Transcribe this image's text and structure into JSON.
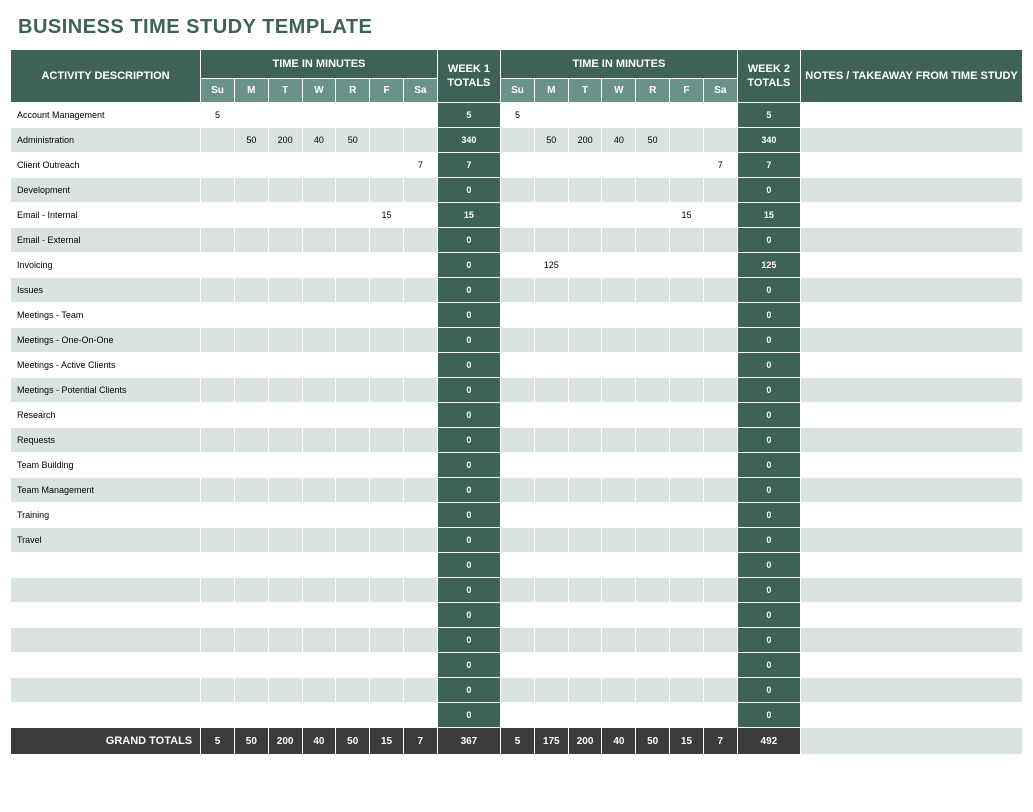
{
  "title": "BUSINESS TIME STUDY TEMPLATE",
  "headers": {
    "activity": "ACTIVITY DESCRIPTION",
    "time_group": "TIME IN MINUTES",
    "week1_totals": "WEEK 1 TOTALS",
    "week2_totals": "WEEK 2 TOTALS",
    "notes": "NOTES / TAKEAWAY FROM TIME STUDY",
    "days": [
      "Su",
      "M",
      "T",
      "W",
      "R",
      "F",
      "Sa"
    ]
  },
  "rows": [
    {
      "activity": "Account Management",
      "w1": [
        "5",
        "",
        "",
        "",
        "",
        "",
        ""
      ],
      "t1": "5",
      "w2": [
        "5",
        "",
        "",
        "",
        "",
        "",
        ""
      ],
      "t2": "5",
      "notes": ""
    },
    {
      "activity": "Administration",
      "w1": [
        "",
        "50",
        "200",
        "40",
        "50",
        "",
        ""
      ],
      "t1": "340",
      "w2": [
        "",
        "50",
        "200",
        "40",
        "50",
        "",
        ""
      ],
      "t2": "340",
      "notes": ""
    },
    {
      "activity": "Client Outreach",
      "w1": [
        "",
        "",
        "",
        "",
        "",
        "",
        "7"
      ],
      "t1": "7",
      "w2": [
        "",
        "",
        "",
        "",
        "",
        "",
        "7"
      ],
      "t2": "7",
      "notes": ""
    },
    {
      "activity": "Development",
      "w1": [
        "",
        "",
        "",
        "",
        "",
        "",
        ""
      ],
      "t1": "0",
      "w2": [
        "",
        "",
        "",
        "",
        "",
        "",
        ""
      ],
      "t2": "0",
      "notes": ""
    },
    {
      "activity": "Email - Internal",
      "w1": [
        "",
        "",
        "",
        "",
        "",
        "15",
        ""
      ],
      "t1": "15",
      "w2": [
        "",
        "",
        "",
        "",
        "",
        "15",
        ""
      ],
      "t2": "15",
      "notes": ""
    },
    {
      "activity": "Email - External",
      "w1": [
        "",
        "",
        "",
        "",
        "",
        "",
        ""
      ],
      "t1": "0",
      "w2": [
        "",
        "",
        "",
        "",
        "",
        "",
        ""
      ],
      "t2": "0",
      "notes": ""
    },
    {
      "activity": "Invoicing",
      "w1": [
        "",
        "",
        "",
        "",
        "",
        "",
        ""
      ],
      "t1": "0",
      "w2": [
        "",
        "125",
        "",
        "",
        "",
        "",
        ""
      ],
      "t2": "125",
      "notes": ""
    },
    {
      "activity": "Issues",
      "w1": [
        "",
        "",
        "",
        "",
        "",
        "",
        ""
      ],
      "t1": "0",
      "w2": [
        "",
        "",
        "",
        "",
        "",
        "",
        ""
      ],
      "t2": "0",
      "notes": ""
    },
    {
      "activity": "Meetings - Team",
      "w1": [
        "",
        "",
        "",
        "",
        "",
        "",
        ""
      ],
      "t1": "0",
      "w2": [
        "",
        "",
        "",
        "",
        "",
        "",
        ""
      ],
      "t2": "0",
      "notes": ""
    },
    {
      "activity": "Meetings - One-On-One",
      "w1": [
        "",
        "",
        "",
        "",
        "",
        "",
        ""
      ],
      "t1": "0",
      "w2": [
        "",
        "",
        "",
        "",
        "",
        "",
        ""
      ],
      "t2": "0",
      "notes": ""
    },
    {
      "activity": "Meetings - Active Clients",
      "w1": [
        "",
        "",
        "",
        "",
        "",
        "",
        ""
      ],
      "t1": "0",
      "w2": [
        "",
        "",
        "",
        "",
        "",
        "",
        ""
      ],
      "t2": "0",
      "notes": ""
    },
    {
      "activity": "Meetings - Potential Clients",
      "w1": [
        "",
        "",
        "",
        "",
        "",
        "",
        ""
      ],
      "t1": "0",
      "w2": [
        "",
        "",
        "",
        "",
        "",
        "",
        ""
      ],
      "t2": "0",
      "notes": ""
    },
    {
      "activity": "Research",
      "w1": [
        "",
        "",
        "",
        "",
        "",
        "",
        ""
      ],
      "t1": "0",
      "w2": [
        "",
        "",
        "",
        "",
        "",
        "",
        ""
      ],
      "t2": "0",
      "notes": ""
    },
    {
      "activity": "Requests",
      "w1": [
        "",
        "",
        "",
        "",
        "",
        "",
        ""
      ],
      "t1": "0",
      "w2": [
        "",
        "",
        "",
        "",
        "",
        "",
        ""
      ],
      "t2": "0",
      "notes": ""
    },
    {
      "activity": "Team Building",
      "w1": [
        "",
        "",
        "",
        "",
        "",
        "",
        ""
      ],
      "t1": "0",
      "w2": [
        "",
        "",
        "",
        "",
        "",
        "",
        ""
      ],
      "t2": "0",
      "notes": ""
    },
    {
      "activity": "Team Management",
      "w1": [
        "",
        "",
        "",
        "",
        "",
        "",
        ""
      ],
      "t1": "0",
      "w2": [
        "",
        "",
        "",
        "",
        "",
        "",
        ""
      ],
      "t2": "0",
      "notes": ""
    },
    {
      "activity": "Training",
      "w1": [
        "",
        "",
        "",
        "",
        "",
        "",
        ""
      ],
      "t1": "0",
      "w2": [
        "",
        "",
        "",
        "",
        "",
        "",
        ""
      ],
      "t2": "0",
      "notes": ""
    },
    {
      "activity": "Travel",
      "w1": [
        "",
        "",
        "",
        "",
        "",
        "",
        ""
      ],
      "t1": "0",
      "w2": [
        "",
        "",
        "",
        "",
        "",
        "",
        ""
      ],
      "t2": "0",
      "notes": ""
    },
    {
      "activity": "",
      "w1": [
        "",
        "",
        "",
        "",
        "",
        "",
        ""
      ],
      "t1": "0",
      "w2": [
        "",
        "",
        "",
        "",
        "",
        "",
        ""
      ],
      "t2": "0",
      "notes": ""
    },
    {
      "activity": "",
      "w1": [
        "",
        "",
        "",
        "",
        "",
        "",
        ""
      ],
      "t1": "0",
      "w2": [
        "",
        "",
        "",
        "",
        "",
        "",
        ""
      ],
      "t2": "0",
      "notes": ""
    },
    {
      "activity": "",
      "w1": [
        "",
        "",
        "",
        "",
        "",
        "",
        ""
      ],
      "t1": "0",
      "w2": [
        "",
        "",
        "",
        "",
        "",
        "",
        ""
      ],
      "t2": "0",
      "notes": ""
    },
    {
      "activity": "",
      "w1": [
        "",
        "",
        "",
        "",
        "",
        "",
        ""
      ],
      "t1": "0",
      "w2": [
        "",
        "",
        "",
        "",
        "",
        "",
        ""
      ],
      "t2": "0",
      "notes": ""
    },
    {
      "activity": "",
      "w1": [
        "",
        "",
        "",
        "",
        "",
        "",
        ""
      ],
      "t1": "0",
      "w2": [
        "",
        "",
        "",
        "",
        "",
        "",
        ""
      ],
      "t2": "0",
      "notes": ""
    },
    {
      "activity": "",
      "w1": [
        "",
        "",
        "",
        "",
        "",
        "",
        ""
      ],
      "t1": "0",
      "w2": [
        "",
        "",
        "",
        "",
        "",
        "",
        ""
      ],
      "t2": "0",
      "notes": ""
    },
    {
      "activity": "",
      "w1": [
        "",
        "",
        "",
        "",
        "",
        "",
        ""
      ],
      "t1": "0",
      "w2": [
        "",
        "",
        "",
        "",
        "",
        "",
        ""
      ],
      "t2": "0",
      "notes": ""
    }
  ],
  "grand": {
    "label": "GRAND TOTALS",
    "w1": [
      "5",
      "50",
      "200",
      "40",
      "50",
      "15",
      "7"
    ],
    "t1": "367",
    "w2": [
      "5",
      "175",
      "200",
      "40",
      "50",
      "15",
      "7"
    ],
    "t2": "492",
    "notes": ""
  }
}
